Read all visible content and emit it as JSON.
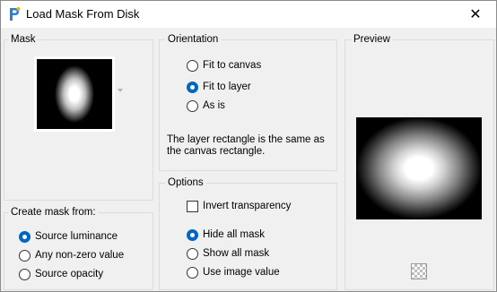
{
  "window": {
    "title": "Load Mask From Disk",
    "app_icon": "psp-brush-icon",
    "close_glyph": "✕"
  },
  "mask_group": {
    "label": "Mask",
    "thumbnail_icon": "mask-thumbnail"
  },
  "orientation": {
    "label": "Orientation",
    "options": [
      "Fit to canvas",
      "Fit to layer",
      "As is"
    ],
    "selected": "Fit to layer",
    "info_line1": "The layer rectangle is the same as",
    "info_line2": "the canvas rectangle."
  },
  "preview": {
    "label": "Preview",
    "transparency_toggle_icon": "checkerboard-icon"
  },
  "create_mask": {
    "label": "Create mask from:",
    "options": [
      "Source luminance",
      "Any non-zero value",
      "Source opacity"
    ],
    "selected": "Source luminance"
  },
  "options": {
    "label": "Options",
    "invert_label": "Invert transparency",
    "invert_checked": false,
    "radios": [
      "Hide all mask",
      "Show all mask",
      "Use image value"
    ],
    "selected": "Hide all mask"
  },
  "colors": {
    "accent": "#0067c0",
    "group_border": "#dcdcdc",
    "background": "#f0f0f0"
  }
}
